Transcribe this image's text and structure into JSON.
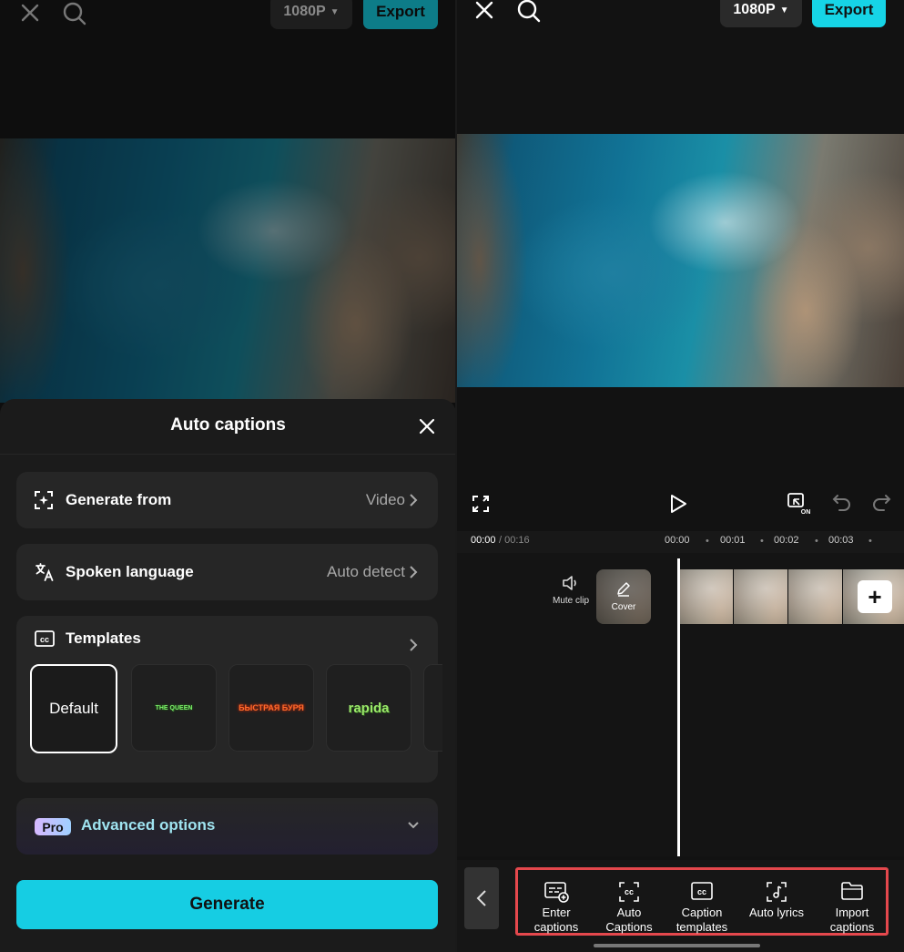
{
  "left_screen": {
    "topbar": {
      "resolution": "1080P",
      "export": "Export"
    },
    "sheet": {
      "title": "Auto captions",
      "generate_from": {
        "label": "Generate from",
        "value": "Video"
      },
      "spoken_language": {
        "label": "Spoken language",
        "value": "Auto detect"
      },
      "templates": {
        "label": "Templates",
        "items": [
          {
            "label": "Default",
            "color": "#ffffff"
          },
          {
            "label": "THE QUEEN",
            "color": "#7cf06a"
          },
          {
            "label": "БЫСТРАЯ БУРЯ",
            "color": "#ff6a2a"
          },
          {
            "label": "rapida",
            "color": "#9be86a"
          }
        ]
      },
      "advanced": {
        "badge": "Pro",
        "label": "Advanced options"
      },
      "generate_button": "Generate"
    }
  },
  "right_screen": {
    "topbar": {
      "resolution": "1080P",
      "export": "Export"
    },
    "timeline": {
      "current": "00:00",
      "total": "/ 00:16",
      "ticks": [
        "00:00",
        "00:01",
        "00:02",
        "00:03"
      ]
    },
    "track": {
      "mute_label": "Mute clip",
      "cover_label": "Cover"
    },
    "tools": [
      {
        "icon": "enter-captions-icon",
        "label": "Enter captions"
      },
      {
        "icon": "auto-captions-icon",
        "label": "Auto Captions"
      },
      {
        "icon": "caption-templates-icon",
        "label": "Caption templates"
      },
      {
        "icon": "auto-lyrics-icon",
        "label": "Auto lyrics"
      },
      {
        "icon": "import-captions-icon",
        "label": "Import captions"
      }
    ]
  },
  "colors": {
    "accent": "#16cde3",
    "highlight_box": "#e5484d",
    "pro_label": "#9fe4f0"
  }
}
